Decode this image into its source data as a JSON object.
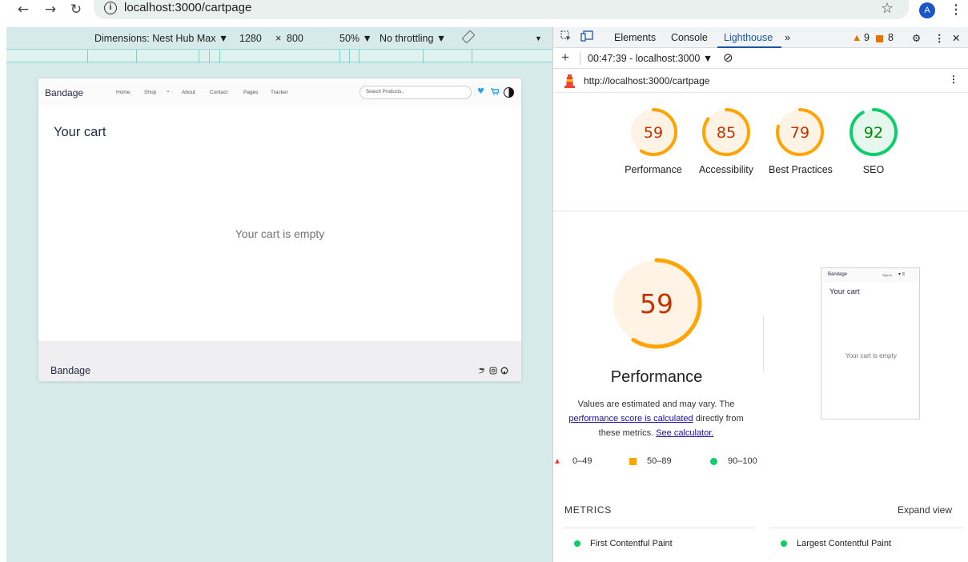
{
  "browser": {
    "back_icon": "←",
    "forward_icon": "→",
    "reload_icon": "↻",
    "info_icon": "i",
    "url": "localhost:3000/cartpage",
    "bookmark_icon": "☆",
    "profile_initial": "A",
    "menu_icon": "⋮"
  },
  "device_toolbar": {
    "dimensions_label": "Dimensions: Nest Hub Max ▼",
    "width": "1280",
    "times": "×",
    "height": "800",
    "zoom": "50% ▼",
    "throttling": "No throttling ▼",
    "more": "▼"
  },
  "site": {
    "logo": "Bandage",
    "nav_links": [
      "Home",
      "Shop",
      "About",
      "Contact",
      "Pages",
      "Tracker"
    ],
    "shop_caret": "⌄",
    "search_placeholder": "Search Products..",
    "cart_title": "Your cart",
    "empty_message": "Your cart is empty",
    "footer_logo": "Bandage",
    "footer_socials": "♥ ◎ ○"
  },
  "devtools": {
    "tabs": [
      "Elements",
      "Console",
      "Lighthouse",
      "»"
    ],
    "warnings_count": "9",
    "issues_count": "8",
    "settings_icon": "⚙",
    "menu_icon": "⋮",
    "close_icon": "✕",
    "add_icon": "+",
    "report_selector": "00:47:39 - localhost:3000 ▼",
    "clear_icon": "⊘",
    "report_url": "http://localhost:3000/cartpage",
    "url_menu_icon": "⋮"
  },
  "lighthouse": {
    "colors": {
      "average": "#ffa400",
      "average_text": "#c33300",
      "average_fill": "#fff3e6",
      "pass": "#0cce6b",
      "pass_text": "#080",
      "pass_fill": "#e6f8ed",
      "fail": "#ff3333"
    },
    "scores": [
      {
        "label": "Performance",
        "value": 59
      },
      {
        "label": "Accessibility",
        "value": 85
      },
      {
        "label": "Best Practices",
        "value": 79
      },
      {
        "label": "SEO",
        "value": 92
      }
    ],
    "perf_title": "Performance",
    "perf_desc_1": "Values are estimated and may vary. The",
    "perf_desc_link": "performance score is calculated",
    "perf_desc_2": "directly from these metrics.",
    "perf_desc_link2": "See calculator.",
    "legend": [
      "0–49",
      "50–89",
      "90–100"
    ],
    "thumbnail": {
      "logo": "Bandage",
      "sign_in": "Sign in",
      "cart_title": "Your cart",
      "empty_message": "Your cart is empty"
    },
    "metrics_header": "METRICS",
    "expand_view": "Expand view",
    "metrics": [
      {
        "label": "First Contentful Paint"
      },
      {
        "label": "Largest Contentful Paint"
      }
    ]
  }
}
